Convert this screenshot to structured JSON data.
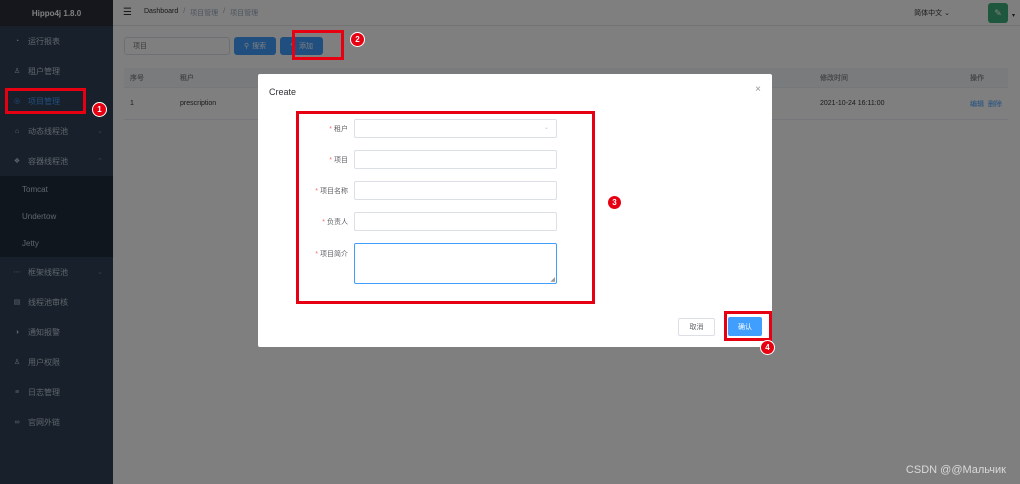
{
  "app": {
    "title": "Hippo4j 1.8.0"
  },
  "sidebar": {
    "items": [
      {
        "label": "运行报表",
        "icon": "dashboard-icon"
      },
      {
        "label": "租户管理",
        "icon": "user-icon"
      },
      {
        "label": "项目管理",
        "icon": "project-icon",
        "active": true
      },
      {
        "label": "动态线程池",
        "icon": "lock-icon",
        "has_children": true
      },
      {
        "label": "容器线程池",
        "icon": "container-icon",
        "has_children": true
      }
    ],
    "subitems": [
      "Tomcat",
      "Undertow",
      "Jetty"
    ],
    "items_after": [
      {
        "label": "框架线程池",
        "icon": "more-icon",
        "has_children": true
      },
      {
        "label": "线程池审核",
        "icon": "audit-icon"
      },
      {
        "label": "通知报警",
        "icon": "bell-icon"
      },
      {
        "label": "用户权限",
        "icon": "person-icon"
      },
      {
        "label": "日志管理",
        "icon": "list-icon"
      },
      {
        "label": "官网外链",
        "icon": "link-icon"
      }
    ]
  },
  "header": {
    "breadcrumb": [
      "Dashboard",
      "/",
      "项目管理",
      "/",
      "项目管理"
    ],
    "lang": "简体中文",
    "avatar_glyph": "✎"
  },
  "toolbar": {
    "search_placeholder": "项目",
    "search_label": "搜索",
    "add_label": "添加"
  },
  "table": {
    "headers": [
      "序号",
      "租户",
      "修改时间",
      "操作"
    ],
    "rows": [
      {
        "idx": "1",
        "tenant": "prescription",
        "time": "2021-10-24 16:11:00",
        "edit": "编辑",
        "delete": "删除"
      }
    ]
  },
  "dialog": {
    "title": "Create",
    "close": "×",
    "fields": [
      {
        "label": "租户",
        "required": "*",
        "type": "select"
      },
      {
        "label": "项目",
        "required": "*",
        "type": "input"
      },
      {
        "label": "项目名称",
        "required": "*",
        "type": "input"
      },
      {
        "label": "负责人",
        "required": "*",
        "type": "input"
      },
      {
        "label": "项目简介",
        "required": "*",
        "type": "textarea"
      }
    ],
    "cancel_label": "取消",
    "confirm_label": "确认"
  },
  "annotations": [
    "1",
    "2",
    "3",
    "4"
  ],
  "watermark": "CSDN @@Мальчик",
  "colors": {
    "primary": "#409eff",
    "sidebar": "#304156",
    "annotation": "#e60012",
    "danger": "#f56c6c"
  }
}
